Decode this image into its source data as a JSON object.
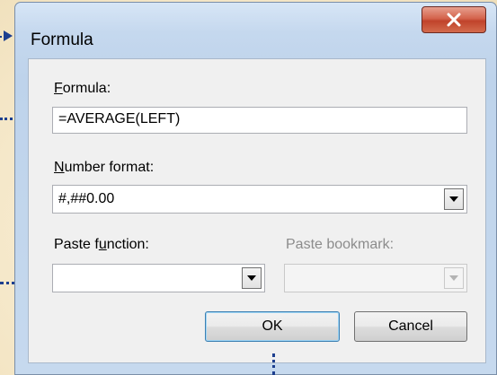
{
  "dialog": {
    "title": "Formula",
    "close_label": "X"
  },
  "formula": {
    "label_accel": "F",
    "label_rest": "ormula:",
    "value": "=AVERAGE(LEFT)"
  },
  "number_format": {
    "label_accel": "N",
    "label_rest": "umber format:",
    "value": "#,##0.00"
  },
  "paste_function": {
    "label_pre": "Paste f",
    "label_accel": "u",
    "label_post": "nction:",
    "value": ""
  },
  "paste_bookmark": {
    "label": "Paste bookmark:",
    "value": "",
    "enabled": false
  },
  "buttons": {
    "ok": "OK",
    "cancel": "Cancel"
  },
  "colors": {
    "background": "#f6ebcf",
    "callout": "#1d3f8f",
    "close_button": "#c7452c"
  }
}
